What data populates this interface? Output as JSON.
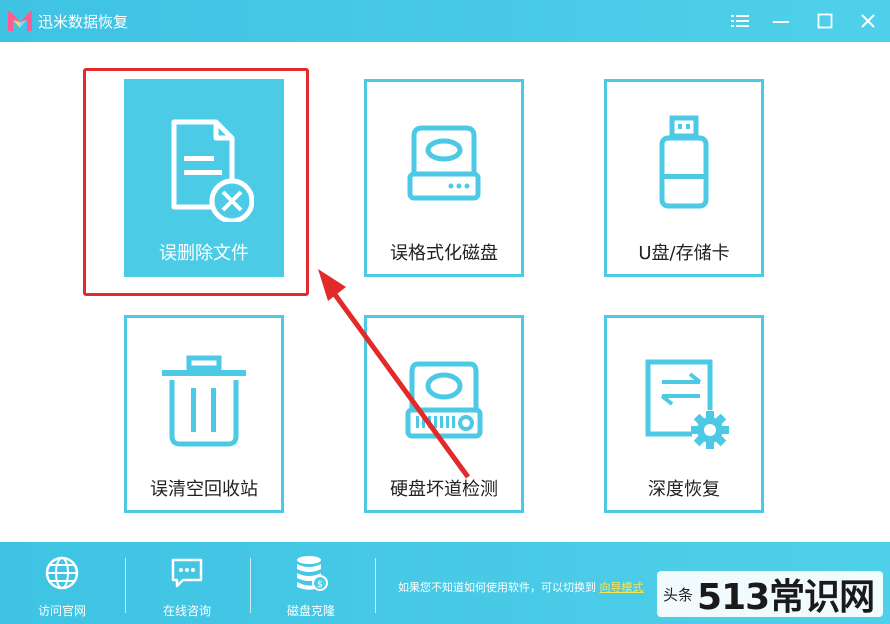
{
  "app": {
    "title": "迅米数据恢复",
    "accent_color": "#4cc9e5",
    "active_tile_color": "#4ccbe6",
    "highlight_color": "#e32a2a"
  },
  "window_controls": [
    "menu-icon",
    "minimize-icon",
    "maximize-icon",
    "close-icon"
  ],
  "tiles": [
    {
      "label": "误删除文件",
      "icon": "deleted-file-icon",
      "active": true
    },
    {
      "label": "误格式化磁盘",
      "icon": "hard-drive-icon",
      "active": false
    },
    {
      "label": "U盘/存储卡",
      "icon": "usb-drive-icon",
      "active": false
    },
    {
      "label": "误清空回收站",
      "icon": "trash-bin-icon",
      "active": false
    },
    {
      "label": "硬盘坏道检测",
      "icon": "disk-scan-icon",
      "active": false
    },
    {
      "label": "深度恢复",
      "icon": "deep-recovery-icon",
      "active": false
    }
  ],
  "bottom_bar": {
    "items": [
      {
        "label": "访问官网",
        "icon": "globe-icon"
      },
      {
        "label": "在线咨询",
        "icon": "chat-icon"
      },
      {
        "label": "磁盘克隆",
        "icon": "database-clone-icon"
      }
    ],
    "hint_text": "如果您不知道如何使用软件，可以切换到",
    "hint_link": "向导模式"
  },
  "watermark": {
    "small": "头条",
    "big": "513常识网"
  }
}
